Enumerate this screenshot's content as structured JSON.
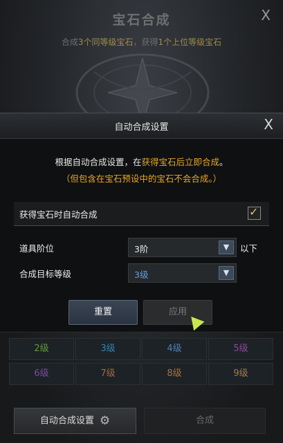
{
  "background": {
    "title": "宝石合成",
    "close": "X",
    "subtitle_parts": [
      "合成",
      "3个同等级宝石",
      "，获得",
      "1个上位等级宝石"
    ]
  },
  "dialog": {
    "title": "自动合成设置",
    "close": "X",
    "desc_line1_parts": [
      "根据自动合成设置，在",
      "获得宝石后立即合成",
      "。"
    ],
    "desc_line2": "（但包含在宝石预设中的宝石不会合成。）",
    "auto_merge_label": "获得宝石时自动合成",
    "auto_merge_checked": true,
    "checkmark": "✓",
    "item_tier_label": "道具阶位",
    "item_tier_value": "3阶",
    "item_tier_suffix": "以下",
    "target_level_label": "合成目标等级",
    "target_level_value": "3级",
    "target_level_color": "#5aa0e6",
    "arrow_icon": "chevron-down",
    "reset_label": "重置",
    "apply_label": "应用"
  },
  "grades": [
    {
      "label": "2级",
      "color": "#5f9a3c"
    },
    {
      "label": "3级",
      "color": "#3b7fae"
    },
    {
      "label": "4级",
      "color": "#4f80b8"
    },
    {
      "label": "5级",
      "color": "#8a4a9c"
    },
    {
      "label": "6级",
      "color": "#7a4aa8"
    },
    {
      "label": "7级",
      "color": "#a26a3a"
    },
    {
      "label": "8级",
      "color": "#a8743c"
    },
    {
      "label": "9级",
      "color": "#a87a44"
    }
  ],
  "bottom": {
    "auto_settings_label": "自动合成设置",
    "merge_label": "合成"
  }
}
